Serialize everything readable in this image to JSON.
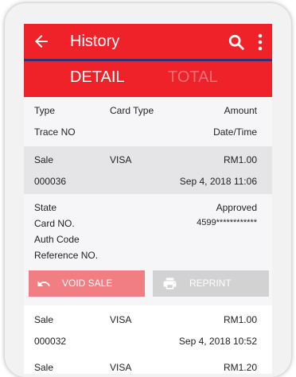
{
  "header": {
    "title": "History"
  },
  "tabs": [
    {
      "label": "DETAIL"
    },
    {
      "label": "TOTAL"
    }
  ],
  "columns": {
    "type": "Type",
    "card_type": "Card Type",
    "amount": "Amount",
    "trace_no": "Trace NO",
    "date_time": "Date/Time"
  },
  "transactions": [
    {
      "type": "Sale",
      "card": "VISA",
      "amount": "RM1.00",
      "trace": "000036",
      "date": "Sep 4, 2018 11:06"
    },
    {
      "type": "Sale",
      "card": "VISA",
      "amount": "RM1.00",
      "trace": "000032",
      "date": "Sep 4, 2018 10:52"
    },
    {
      "type": "Sale",
      "card": "VISA",
      "amount": "RM1.20"
    }
  ],
  "detail": {
    "state_label": "State",
    "state_value": "Approved",
    "card_label": "Card NO.",
    "card_value": "4599************",
    "auth_label": "Auth Code",
    "ref_label": "Reference NO."
  },
  "actions": {
    "void_label": "VOID SALE",
    "reprint_label": "REPRINT"
  },
  "colors": {
    "primary": "#ee2228",
    "void": "#f07e83",
    "reprint": "#d2d2d2"
  }
}
